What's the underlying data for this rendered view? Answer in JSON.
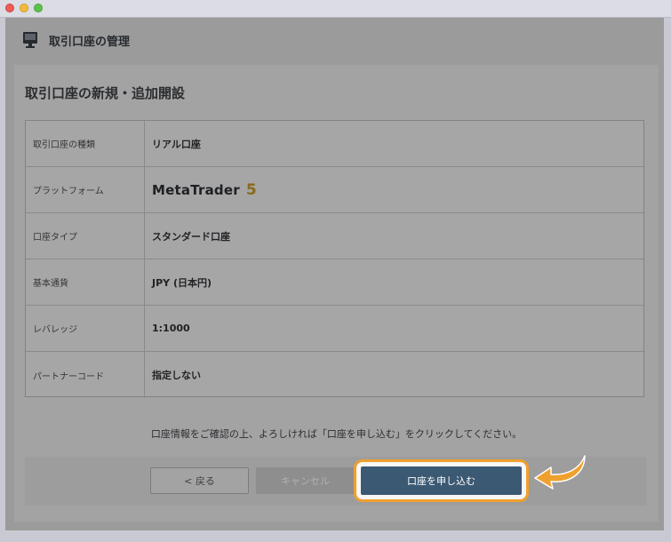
{
  "window": {
    "header_title": "取引口座の管理",
    "monitor_icon": "monitor-icon"
  },
  "panel": {
    "title": "取引口座の新規・追加開設",
    "rows": [
      {
        "label": "取引口座の種類",
        "value": "リアル口座"
      },
      {
        "label": "プラットフォーム",
        "value": "MetaTrader 5"
      },
      {
        "label": "口座タイプ",
        "value": "スタンダード口座"
      },
      {
        "label": "基本通貨",
        "value": "JPY (日本円)"
      },
      {
        "label": "レバレッジ",
        "value": "1:1000"
      },
      {
        "label": "パートナーコード",
        "value": "指定しない"
      }
    ],
    "platform_logo": {
      "name": "MetaTrader",
      "version": "5"
    },
    "confirm_text": "口座情報をご確認の上、よろしければ「口座を申し込む」をクリックしてください。"
  },
  "buttons": {
    "back": "< 戻る",
    "cancel": "キャンセル",
    "apply": "口座を申し込む"
  },
  "colors": {
    "highlight": "#f0a02e",
    "apply_button": "#3b5973"
  }
}
